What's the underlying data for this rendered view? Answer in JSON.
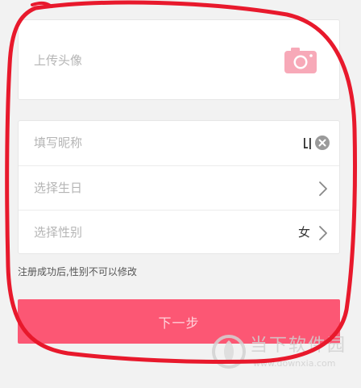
{
  "avatar": {
    "label": "上传头像",
    "icon": "camera-icon",
    "icon_color": "#f7a9b8"
  },
  "form": {
    "nickname_label": "填写昵称",
    "birthday_label": "选择生日",
    "gender_label": "选择性别",
    "gender_value": "女"
  },
  "hint": "注册成功后,性别不可以修改",
  "next_button": {
    "label": "下一步",
    "bg_color": "#fc5774"
  },
  "watermark": {
    "title": "当下软件园",
    "url": "www.downxia.com"
  },
  "annotation_color": "#e8192c"
}
